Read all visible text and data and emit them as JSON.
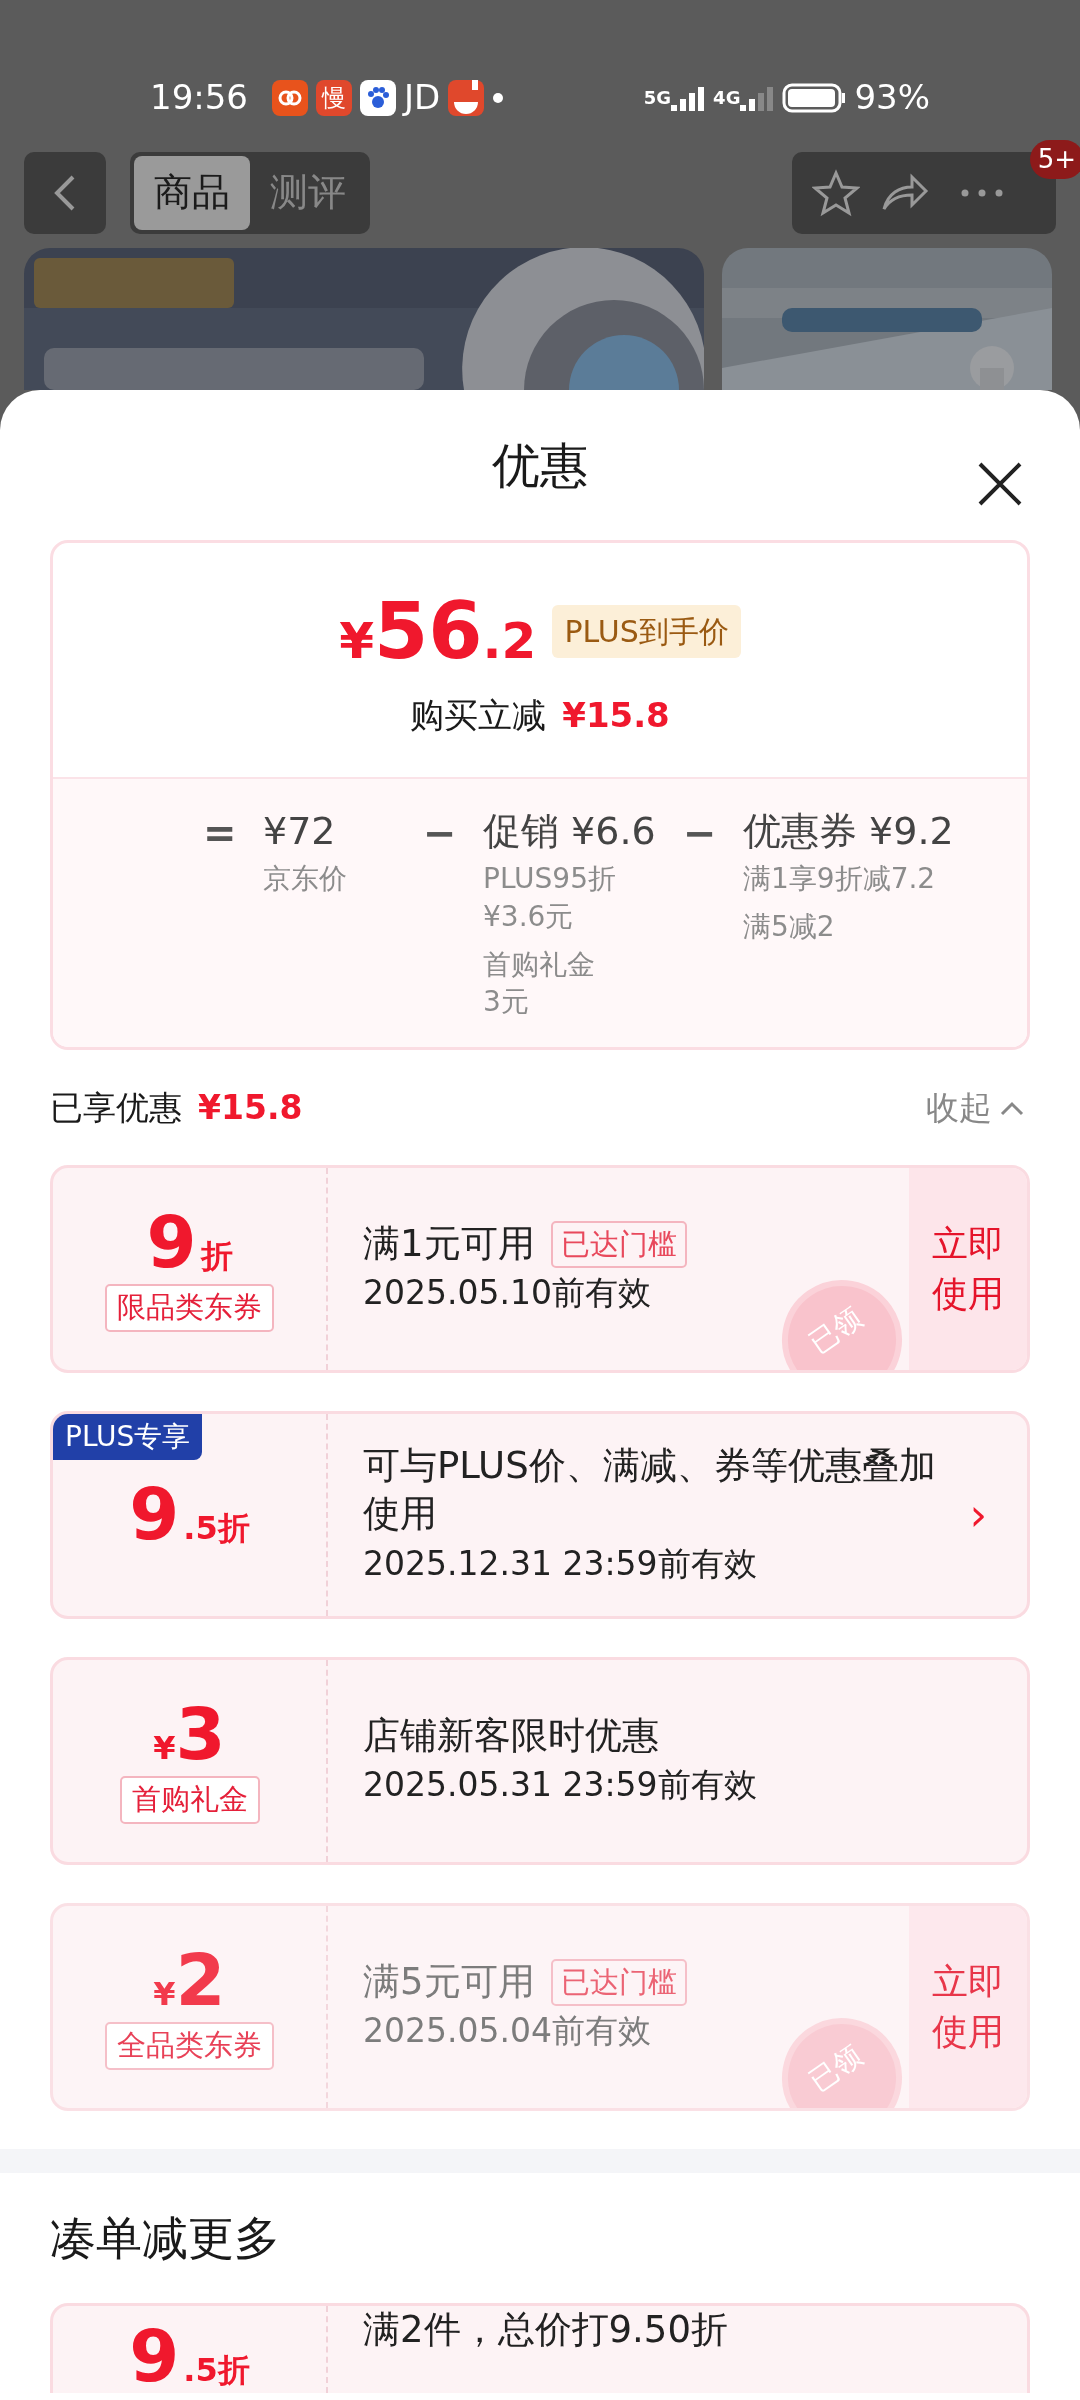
{
  "status_bar": {
    "time": "19:56",
    "app_icon_text": "慢",
    "app_text": "JD",
    "network_1": "5G",
    "network_2": "4G",
    "battery": "93%"
  },
  "header": {
    "tabs": [
      {
        "label": "商品",
        "selected": true
      },
      {
        "label": "测评",
        "selected": false
      }
    ],
    "badge": "5+"
  },
  "sheet": {
    "title": "优惠"
  },
  "summary": {
    "currency": "¥",
    "price_int": "56",
    "price_dec": ".2",
    "price_tag": "PLUS到手价",
    "saving_label": "购买立减",
    "saving": "¥15.8",
    "breakdown": [
      {
        "operator": "=",
        "title": "¥72",
        "notes": [
          [
            "京东价"
          ]
        ]
      },
      {
        "operator": "−",
        "title": "促销 ¥6.6",
        "notes": [
          [
            "PLUS95折",
            "¥3.6元"
          ],
          [
            "首购礼金",
            "3元"
          ]
        ]
      },
      {
        "operator": "−",
        "title": "优惠券 ¥9.2",
        "notes": [
          [
            "满1享9折减7.2"
          ],
          [
            "满5减2"
          ]
        ]
      }
    ]
  },
  "enjoyed": {
    "label": "已享优惠",
    "amount": "¥15.8",
    "toggle": "收起",
    "expanded": true
  },
  "coupons": [
    {
      "kind": "discount",
      "value": "9",
      "suffix": "折",
      "tag": "限品类东券",
      "title": "满1元可用",
      "threshold": "已达门槛",
      "validity": "2025.05.10前有效",
      "action": "立即使用",
      "stamp": "已领",
      "faded": false
    },
    {
      "kind": "plus",
      "ribbon": "PLUS专享",
      "value": "9",
      "suffix": ".5折",
      "title": "可与PLUS价、满减、券等优惠叠加使用",
      "validity": "2025.12.31 23:59前有效",
      "arrow": "›",
      "faded": false
    },
    {
      "kind": "amount",
      "currency": "¥",
      "value": "3",
      "tag": "首购礼金",
      "title": "店铺新客限时优惠",
      "validity": "2025.05.31 23:59前有效",
      "faded": false
    },
    {
      "kind": "amount",
      "currency": "¥",
      "value": "2",
      "tag": "全品类东券",
      "title": "满5元可用",
      "threshold": "已达门槛",
      "validity": "2025.05.04前有效",
      "action": "立即使用",
      "stamp": "已领",
      "faded": true
    }
  ],
  "more": {
    "title": "凑单减更多",
    "coupons": [
      {
        "kind": "discount",
        "value": "9",
        "suffix": ".5折",
        "title": "满2件，总价打9.50折"
      }
    ]
  }
}
